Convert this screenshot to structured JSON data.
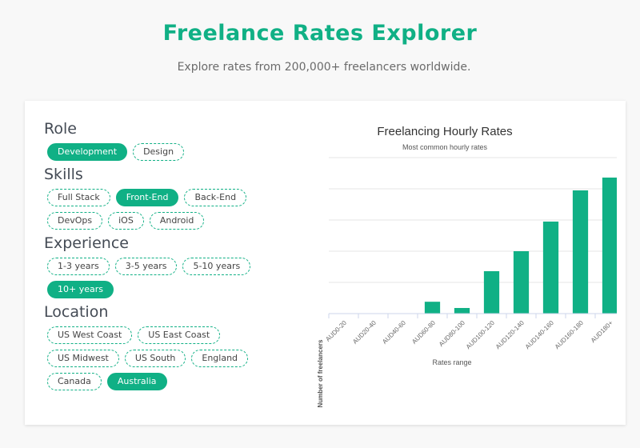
{
  "header": {
    "title": "Freelance Rates Explorer",
    "subtitle": "Explore rates from 200,000+ freelancers worldwide."
  },
  "filters": [
    {
      "title": "Role",
      "options": [
        {
          "label": "Development",
          "active": true
        },
        {
          "label": "Design",
          "active": false
        }
      ]
    },
    {
      "title": "Skills",
      "options": [
        {
          "label": "Full Stack",
          "active": false
        },
        {
          "label": "Front-End",
          "active": true
        },
        {
          "label": "Back-End",
          "active": false
        },
        {
          "label": "DevOps",
          "active": false
        },
        {
          "label": "iOS",
          "active": false
        },
        {
          "label": "Android",
          "active": false
        }
      ]
    },
    {
      "title": "Experience",
      "options": [
        {
          "label": "1-3 years",
          "active": false
        },
        {
          "label": "3-5 years",
          "active": false
        },
        {
          "label": "5-10 years",
          "active": false
        },
        {
          "label": "10+ years",
          "active": true
        }
      ]
    },
    {
      "title": "Location",
      "options": [
        {
          "label": "US West Coast",
          "active": false
        },
        {
          "label": "US East Coast",
          "active": false
        },
        {
          "label": "US Midwest",
          "active": false
        },
        {
          "label": "US South",
          "active": false
        },
        {
          "label": "England",
          "active": false
        },
        {
          "label": "Canada",
          "active": false
        },
        {
          "label": "Australia",
          "active": true
        }
      ]
    }
  ],
  "colors": {
    "accent": "#10b085",
    "grid": "#e6e6e6",
    "axis": "#ccd6eb"
  },
  "chart_data": {
    "type": "bar",
    "title": "Freelancing Hourly Rates",
    "subtitle": "Most common hourly rates",
    "xlabel": "Rates range",
    "ylabel": "Number of freelancers",
    "categories": [
      "AUD0-20",
      "AUD20-40",
      "AUD40-60",
      "AUD60-80",
      "AUD80-100",
      "AUD100-120",
      "AUD120-140",
      "AUD140-160",
      "AUD160-180",
      "AUD180+"
    ],
    "values": [
      0,
      0,
      0,
      0.38,
      0.18,
      1.36,
      2.0,
      2.95,
      3.95,
      4.36
    ],
    "ylim": [
      0,
      5
    ],
    "yticks": [
      0,
      1,
      2,
      3,
      4,
      5
    ],
    "ytick_labels_visible": false,
    "grid": true,
    "legend": "none"
  }
}
